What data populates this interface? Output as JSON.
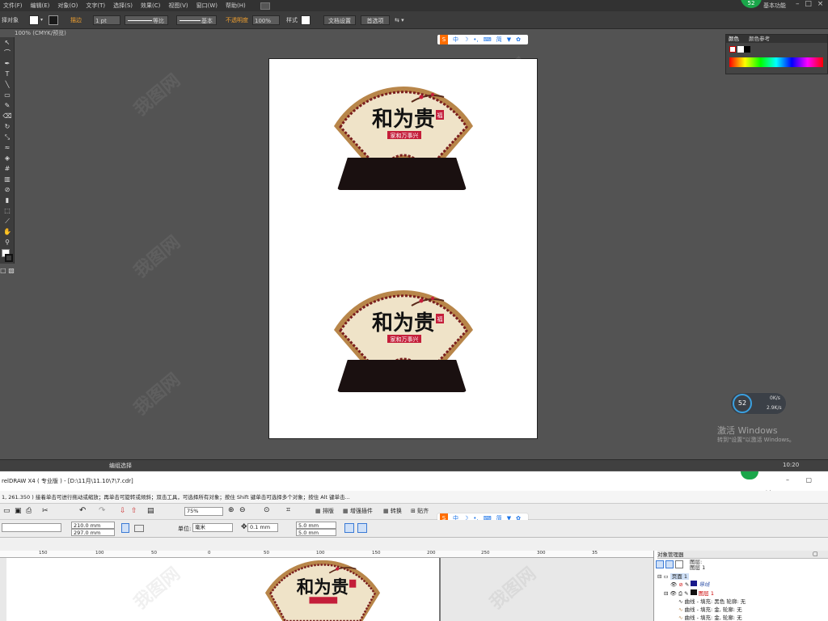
{
  "illustrator": {
    "menu": [
      "文件(F)",
      "编辑(E)",
      "对象(O)",
      "文字(T)",
      "选择(S)",
      "效果(C)",
      "视图(V)",
      "窗口(W)",
      "帮助(H)"
    ],
    "workspace_label": "基本功能",
    "control": {
      "select_label": "择对象",
      "stroke_label": "描边",
      "stroke_weight": "1 pt",
      "profile_label": "等比",
      "brush_label": "基本",
      "opacity_label": "不透明度",
      "opacity_value": "100%",
      "style_label": "样式",
      "doc_setup_button": "文档设置",
      "prefs_button": "首选项"
    },
    "doc_tab": "100% (CMYK/预览)",
    "color_panel": {
      "tab_color": "颜色",
      "tab_ref": "颜色参考"
    },
    "status_text": "编组选择",
    "fan_title": "和为贵",
    "fan_subtitle": "家和万事兴",
    "stamp_text": "福",
    "cpu_percent": "52",
    "net_up": "0K/s",
    "net_down": "2.9K/s",
    "windows_activation": {
      "title": "激活 Windows",
      "subtitle": "转到\"设置\"以激活 Windows。"
    },
    "clock": "10:20"
  },
  "ime_bar": {
    "items": [
      "中",
      "简"
    ]
  },
  "avatar_badge": "52",
  "watermark": "我图网",
  "corel": {
    "title": "relDRAW X4 ( 专业版 ) - [D:\\11月\\11.10\\7\\7.cdr]",
    "hint": "1, 261.350 )      接着单击可进行拖动或缩放；再单击可旋转或倾斜；双击工具，可选择所有对象；按住 Shift 键单击可选择多个对象；按住 Alt 键单击...",
    "toolbar": {
      "zoom": "75%",
      "btn_publish": "排版",
      "btn_plugin": "增强插件",
      "btn_convert": "转换",
      "btn_paste": "贴齐"
    },
    "props": {
      "width": "210.0 mm",
      "height": "297.0 mm",
      "unit_label": "单位:",
      "unit_value": "毫米",
      "nudge": "0.1 mm",
      "dup_x": "5.0 mm",
      "dup_y": "5.0 mm"
    },
    "ruler": [
      "150",
      "100",
      "50",
      "0",
      "50",
      "100",
      "150",
      "200",
      "250",
      "300",
      "35"
    ],
    "obj_manager": {
      "title": "对象管理器",
      "layer_header": "图层:",
      "layer_name": "图层 1",
      "page": "页面 1",
      "guides": "导线",
      "layer1": "图层 1",
      "curve1": "曲线 - 填充: 黑色  轮廓: 无",
      "curve2": "曲线 - 填充: 金, 轮廓: 无",
      "curve3": "曲线 - 填充: 金, 轮廓: 无"
    }
  }
}
